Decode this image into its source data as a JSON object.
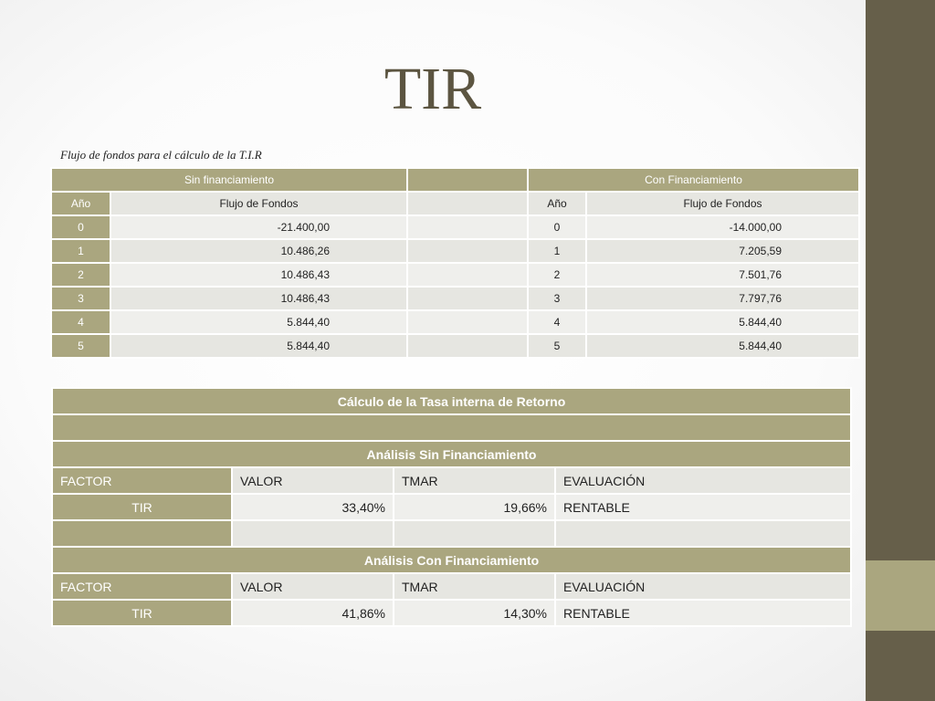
{
  "slide": {
    "title": "TIR",
    "subtitle": "Flujo de fondos para el cálculo de la T.I.R"
  },
  "cash_flow": {
    "without_header": "Sin financiamiento",
    "with_header": "Con Financiamiento",
    "col_year": "Año",
    "col_flow": "Flujo de Fondos",
    "rows": [
      {
        "year": "0",
        "without": "-21.400,00",
        "with_year": "0",
        "with": "-14.000,00"
      },
      {
        "year": "1",
        "without": "10.486,26",
        "with_year": "1",
        "with": "7.205,59"
      },
      {
        "year": "2",
        "without": "10.486,43",
        "with_year": "2",
        "with": "7.501,76"
      },
      {
        "year": "3",
        "without": "10.486,43",
        "with_year": "3",
        "with": "7.797,76"
      },
      {
        "year": "4",
        "without": "5.844,40",
        "with_year": "4",
        "with": "5.844,40"
      },
      {
        "year": "5",
        "without": "5.844,40",
        "with_year": "5",
        "with": "5.844,40"
      }
    ]
  },
  "irr": {
    "title": "Cálculo de la Tasa interna de Retorno",
    "without": {
      "heading": "Análisis Sin Financiamiento",
      "cols": [
        "FACTOR",
        "VALOR",
        "TMAR",
        "EVALUACIÓN"
      ],
      "row": {
        "factor": "TIR",
        "valor": "33,40%",
        "tmar": "19,66%",
        "evaluacion": "RENTABLE"
      }
    },
    "with": {
      "heading": "Análisis Con Financiamiento",
      "cols": [
        "FACTOR",
        "VALOR",
        "TMAR",
        "EVALUACIÓN"
      ],
      "row": {
        "factor": "TIR",
        "valor": "41,86%",
        "tmar": "14,30%",
        "evaluacion": "RENTABLE"
      }
    }
  },
  "colors": {
    "accent": "#aaa67f",
    "sidebar_dark": "#665f4a",
    "title": "#5c5541"
  }
}
